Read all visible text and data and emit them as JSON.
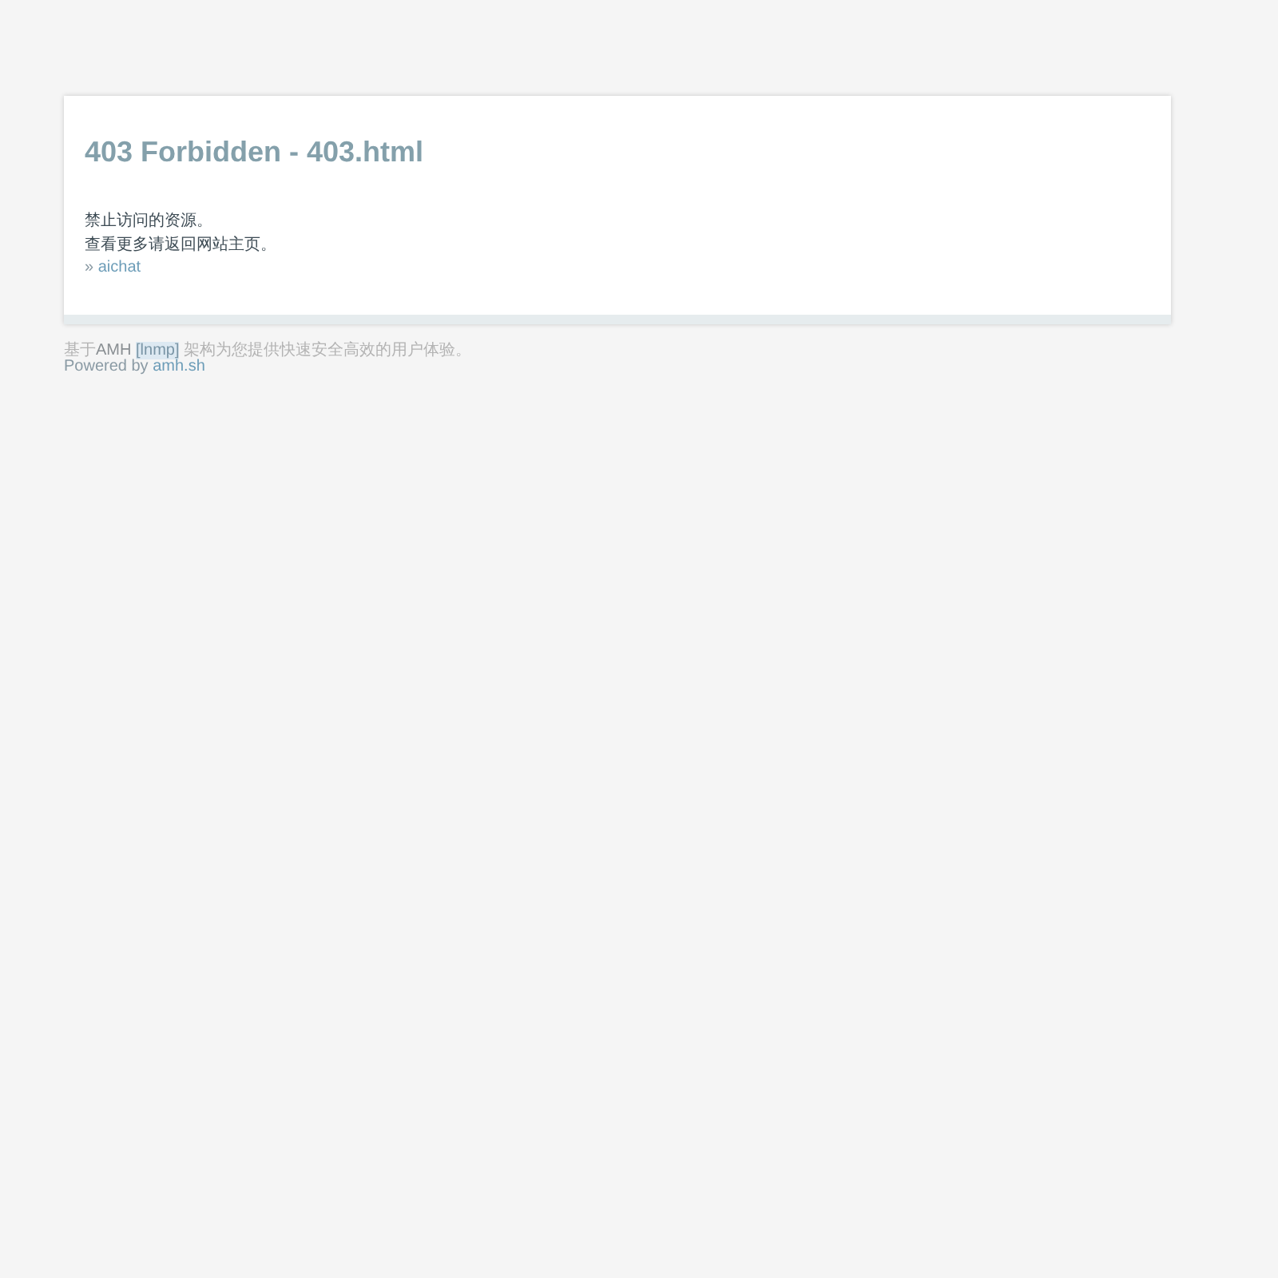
{
  "panel": {
    "title": "403 Forbidden - 403.html",
    "lines": [
      "禁止访问的资源。",
      "查看更多请返回网站主页。"
    ],
    "back_link": {
      "marker": "»",
      "label": "aichat"
    }
  },
  "footer": {
    "sentence": {
      "prefix": "基于",
      "link_1": "AMH",
      "link_2": "[lnmp]",
      "suffix": "架构为您提供快速安全高效的用户体验。"
    },
    "powered": {
      "text": "Powered by",
      "link": "amh.sh"
    }
  }
}
